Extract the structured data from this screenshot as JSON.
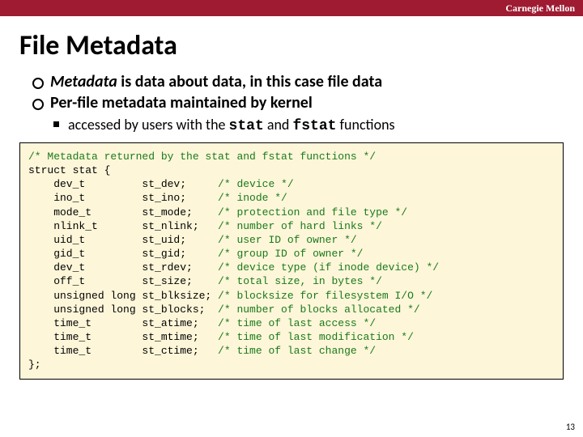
{
  "brand": "Carnegie Mellon",
  "title": "File Metadata",
  "bullets": [
    {
      "level": 1,
      "pre_em": "Metadata",
      "rest": " is data about data, in this case file data"
    },
    {
      "level": 1,
      "text": "Per-file metadata maintained by kernel"
    },
    {
      "level": 2,
      "pre": "accessed by users with the ",
      "code1": "stat",
      "mid": " and ",
      "code2": "fstat",
      "post": " functions"
    }
  ],
  "code": {
    "header_comment": "/* Metadata returned by the stat and fstat functions */",
    "struct_open": "struct stat {",
    "fields": [
      {
        "type": "dev_t",
        "name": "st_dev;",
        "comment": "/* device */"
      },
      {
        "type": "ino_t",
        "name": "st_ino;",
        "comment": "/* inode */"
      },
      {
        "type": "mode_t",
        "name": "st_mode;",
        "comment": "/* protection and file type */"
      },
      {
        "type": "nlink_t",
        "name": "st_nlink;",
        "comment": "/* number of hard links */"
      },
      {
        "type": "uid_t",
        "name": "st_uid;",
        "comment": "/* user ID of owner */"
      },
      {
        "type": "gid_t",
        "name": "st_gid;",
        "comment": "/* group ID of owner */"
      },
      {
        "type": "dev_t",
        "name": "st_rdev;",
        "comment": "/* device type (if inode device) */"
      },
      {
        "type": "off_t",
        "name": "st_size;",
        "comment": "/* total size, in bytes */"
      },
      {
        "type": "unsigned long",
        "name": "st_blksize;",
        "comment": "/* blocksize for filesystem I/O */"
      },
      {
        "type": "unsigned long",
        "name": "st_blocks;",
        "comment": "/* number of blocks allocated */"
      },
      {
        "type": "time_t",
        "name": "st_atime;",
        "comment": "/* time of last access */"
      },
      {
        "type": "time_t",
        "name": "st_mtime;",
        "comment": "/* time of last modification */"
      },
      {
        "type": "time_t",
        "name": "st_ctime;",
        "comment": "/* time of last change */"
      }
    ],
    "struct_close": "};"
  },
  "pagenum": "13",
  "col": {
    "indent": 4,
    "type_w": 14,
    "name_w": 12
  }
}
